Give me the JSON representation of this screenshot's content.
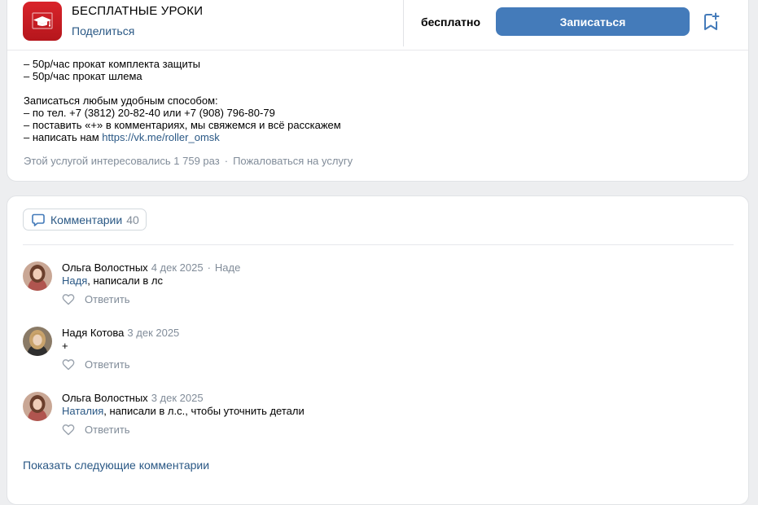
{
  "service": {
    "title": "БЕСПЛАТНЫЕ УРОКИ",
    "share_label": "Поделиться",
    "price": "бесплатно",
    "signup_label": "Записаться",
    "logo_icon": "graduation-cap-icon",
    "brand_color": "#d9232a",
    "accent_color": "#447bba"
  },
  "description": {
    "lines": [
      "– 50р/час прокат комплекта защиты",
      "– 50р/час прокат шлема",
      "",
      "Записаться любым удобным способом:",
      "– по тел. +7 (3812) 20-82-40 или +7 (908) 796-80-79",
      "– поставить «+» в комментариях, мы свяжемся и всё расскажем"
    ],
    "last_line_prefix": "– написать нам ",
    "link": "https://vk.me/roller_omsk"
  },
  "meta": {
    "interest": "Этой услугой интересовались 1 759 раз",
    "separator": "·",
    "report": "Пожаловаться на услугу"
  },
  "comments": {
    "tab_label": "Комментарии",
    "count": "40",
    "reply_label": "Ответить",
    "show_more": "Показать следующие комментарии",
    "items": [
      {
        "author": "Ольга Волостных",
        "date": "4 дек 2025",
        "separator": "·",
        "reply_to": "Наде",
        "mention": "Надя",
        "text": ", написали в лс"
      },
      {
        "author": "Надя Котова",
        "date": "3 дек 2025",
        "text": "+"
      },
      {
        "author": "Ольга Волостных",
        "date": "3 дек 2025",
        "mention": "Наталия",
        "text": ", написали в л.с., чтобы уточнить детали"
      }
    ]
  }
}
